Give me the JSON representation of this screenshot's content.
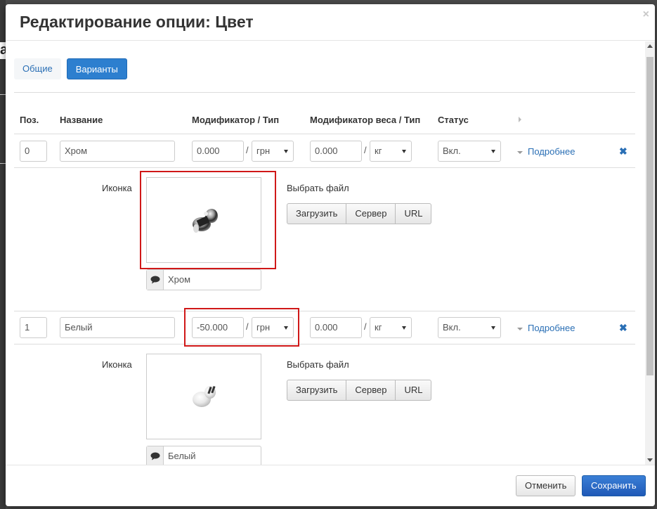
{
  "backdrop": {
    "peek_letter": "а"
  },
  "modal": {
    "title": "Редактирование опции: Цвет",
    "close": "×"
  },
  "tabs": [
    {
      "label": "Общие",
      "active": false
    },
    {
      "label": "Варианты",
      "active": true
    }
  ],
  "columns": {
    "pos": "Поз.",
    "name": "Название",
    "modifier": "Модификатор / Тип",
    "weight_modifier": "Модификатор веса / Тип",
    "status": "Статус"
  },
  "variants": [
    {
      "pos": "0",
      "name": "Хром",
      "modifier": "0.000",
      "modifier_type": "грн",
      "weight_modifier": "0.000",
      "weight_type": "кг",
      "status": "Вкл.",
      "more": "Подробнее",
      "icon_label": "Иконка",
      "file_label": "Выбрать файл",
      "buttons": [
        "Загрузить",
        "Сервер",
        "URL"
      ],
      "caption": "Хром",
      "image": "chrome-knob"
    },
    {
      "pos": "1",
      "name": "Белый",
      "modifier": "-50.000",
      "modifier_type": "грн",
      "weight_modifier": "0.000",
      "weight_type": "кг",
      "status": "Вкл.",
      "more": "Подробнее",
      "icon_label": "Иконка",
      "file_label": "Выбрать файл",
      "buttons": [
        "Загрузить",
        "Сервер",
        "URL"
      ],
      "caption": "Белый",
      "image": "white-knob"
    }
  ],
  "separator": "/",
  "delete_icon": "✖",
  "footer": {
    "cancel": "Отменить",
    "save": "Сохранить"
  },
  "colors": {
    "primary": "#2d7fcf",
    "link": "#2a6fb5",
    "highlight": "#d01818"
  }
}
